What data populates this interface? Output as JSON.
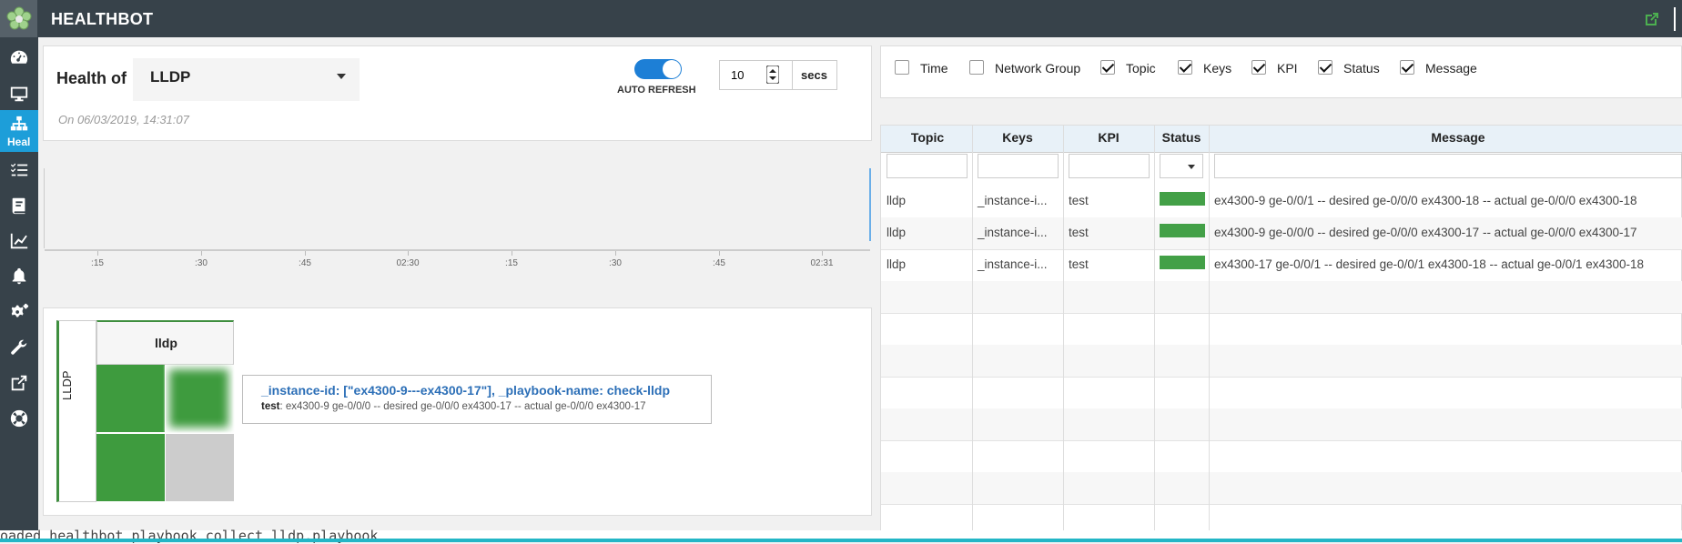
{
  "app": {
    "title": "HEALTHBOT"
  },
  "sidebar": {
    "items": [
      {
        "icon": "dashboard-icon"
      },
      {
        "icon": "monitor-icon"
      },
      {
        "icon": "health-icon",
        "label": "Heal",
        "active": true
      },
      {
        "icon": "list-icon"
      },
      {
        "icon": "book-icon"
      },
      {
        "icon": "chart-icon"
      },
      {
        "icon": "bell-icon"
      },
      {
        "icon": "gears-icon"
      },
      {
        "icon": "wrench-icon"
      },
      {
        "icon": "external-link-icon"
      },
      {
        "icon": "lifebuoy-icon"
      }
    ]
  },
  "health": {
    "label": "Health of",
    "topic": "LLDP",
    "auto_refresh_label": "AUTO REFRESH",
    "auto_refresh_on": true,
    "interval": "10",
    "interval_unit": "secs",
    "timestamp": "On 06/03/2019, 14:31:07"
  },
  "timeline": {
    "ticks": [
      ":15",
      ":30",
      ":45",
      "02:30",
      ":15",
      ":30",
      ":45",
      "02:31"
    ]
  },
  "heatmap": {
    "row_label": "LLDP",
    "column_label": "lldp",
    "cells": [
      "green",
      "green-blurred",
      "green",
      "gray"
    ],
    "tooltip": {
      "title": "_instance-id: [\"ex4300-9---ex4300-17\"], _playbook-name: check-lldp",
      "kpi": "test",
      "message": ": ex4300-9 ge-0/0/0 -- desired ge-0/0/0 ex4300-17 -- actual ge-0/0/0 ex4300-17"
    }
  },
  "filters": [
    {
      "label": "Time",
      "checked": false
    },
    {
      "label": "Network Group",
      "checked": false
    },
    {
      "label": "Topic",
      "checked": true
    },
    {
      "label": "Keys",
      "checked": true
    },
    {
      "label": "KPI",
      "checked": true
    },
    {
      "label": "Status",
      "checked": true
    },
    {
      "label": "Message",
      "checked": true
    }
  ],
  "table": {
    "columns": [
      "Topic",
      "Keys",
      "KPI",
      "Status",
      "Message"
    ],
    "rows": [
      {
        "topic": "lldp",
        "keys": "_instance-i...",
        "kpi": "test",
        "status": "green",
        "message": "ex4300-9 ge-0/0/1 -- desired ge-0/0/0 ex4300-18 -- actual ge-0/0/0 ex4300-18"
      },
      {
        "topic": "lldp",
        "keys": "_instance-i...",
        "kpi": "test",
        "status": "green",
        "message": "ex4300-9 ge-0/0/0 -- desired ge-0/0/0 ex4300-17 -- actual ge-0/0/0 ex4300-17"
      },
      {
        "topic": "lldp",
        "keys": "_instance-i...",
        "kpi": "test",
        "status": "green",
        "message": "ex4300-17 ge-0/0/1 -- desired ge-0/0/1 ex4300-18 -- actual ge-0/0/1 ex4300-18"
      }
    ]
  },
  "console": {
    "text": "oaded healthbot playbook collect lldp.playbook"
  },
  "colors": {
    "topbar": "#37424a",
    "accent": "#1d9ed9",
    "status_green": "#43a047",
    "cell_gray": "#cccccc"
  }
}
